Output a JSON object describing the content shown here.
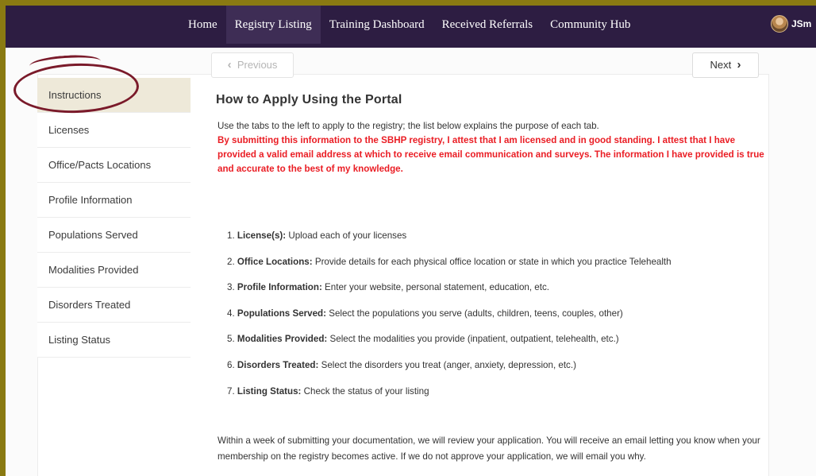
{
  "nav": {
    "items": [
      {
        "label": "Home"
      },
      {
        "label": "Registry Listing"
      },
      {
        "label": "Training Dashboard"
      },
      {
        "label": "Received Referrals"
      },
      {
        "label": "Community Hub"
      }
    ],
    "active_index": 1,
    "user": "JSm"
  },
  "sidebar": {
    "items": [
      {
        "label": "Instructions"
      },
      {
        "label": "Licenses"
      },
      {
        "label": "Office/Pacts Locations"
      },
      {
        "label": "Profile Information"
      },
      {
        "label": "Populations Served"
      },
      {
        "label": "Modalities Provided"
      },
      {
        "label": "Disorders Treated"
      },
      {
        "label": "Listing Status"
      }
    ],
    "active_index": 0
  },
  "pager": {
    "previous_label": "Previous",
    "next_label": "Next",
    "prev_icon": "chevron-left-icon",
    "next_icon": "chevron-right-icon"
  },
  "main": {
    "heading": "How to Apply Using the Portal",
    "intro": "Use the tabs to the left to apply to the registry; the list below explains the purpose of each tab.",
    "attestation": "By submitting this information to the SBHP registry, I attest that I am licensed and in good standing. I attest that I have provided a valid email address at which to receive email communication and surveys. The information I have provided is true and accurate to the best of my knowledge.",
    "list": [
      {
        "num": "1.",
        "title": "License(s):",
        "text": " Upload each of your licenses"
      },
      {
        "num": "2.",
        "title": "Office Locations:",
        "text": " Provide details for each physical office location or state in which you practice Telehealth"
      },
      {
        "num": "3.",
        "title": "Profile Information:",
        "text": " Enter your website, personal statement, education, etc."
      },
      {
        "num": "4.",
        "title": "Populations Served:",
        "text": " Select the populations you serve (adults, children, teens, couples, other)"
      },
      {
        "num": "5.",
        "title": "Modalities Provided:",
        "text": " Select the modalities you provide (inpatient, outpatient, telehealth, etc.)"
      },
      {
        "num": "6.",
        "title": "Disorders Treated:",
        "text": " Select the disorders you treat (anger, anxiety, depression, etc.)"
      },
      {
        "num": "7.",
        "title": "Listing Status:",
        "text": " Check the status of your listing"
      }
    ],
    "outro": "Within a week of submitting your documentation, we will review your application. You will receive an email letting you know when your membership on the registry becomes active. If we do not approve your application, we will email you why."
  },
  "colors": {
    "topbar": "#2d1d42",
    "frame": "#8a7a12",
    "highlight_ring": "#7a1a2a",
    "attestation_red": "#ea1d24",
    "active_tab_bg": "#eee9d9"
  }
}
